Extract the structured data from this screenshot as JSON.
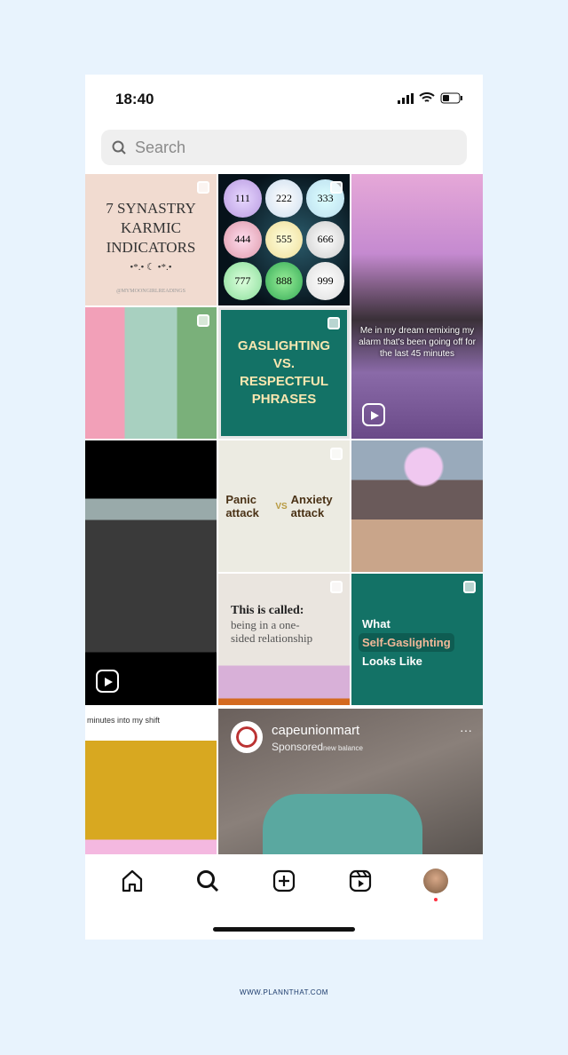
{
  "status": {
    "time": "18:40"
  },
  "search": {
    "placeholder": "Search"
  },
  "tiles": {
    "t1": {
      "title": "7 SYNASTRY KARMIC INDICATORS",
      "stars": "•*.• ☾ •*.•",
      "handle": "@MYMOONGIRLREADINGS"
    },
    "t2": {
      "numbers": [
        "111",
        "222",
        "333",
        "444",
        "555",
        "666",
        "777",
        "888",
        "999"
      ]
    },
    "t3": {
      "caption": "Me in my dream remixing my alarm that's been going off for the last 45 minutes"
    },
    "t5": {
      "title": "GASLIGHTING VS. RESPECTFUL PHRASES"
    },
    "t7": {
      "left": "Panic attack",
      "vs": "VS",
      "right": "Anxiety attack"
    },
    "t9": {
      "bold": "This is called:",
      "rest": "being in a one-sided relationship"
    },
    "t10": {
      "line1": "What",
      "line2": "Self-Gaslighting",
      "line3": "Looks Like"
    },
    "t11": {
      "caption": "minutes into my shift"
    },
    "ad": {
      "account": "capeunionmart",
      "sponsored": "Sponsored",
      "brand": "new balance",
      "more": "···"
    }
  },
  "footer": "WWW.PLANNTHAT.COM",
  "colors": {
    "background": "#e8f3fd",
    "teal": "#137266",
    "notification": "#ff3040"
  }
}
